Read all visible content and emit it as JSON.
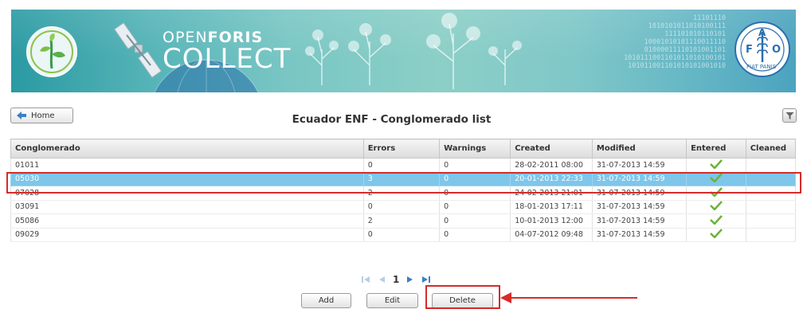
{
  "banner": {
    "brand_line1_light": "OPEN",
    "brand_line1_bold": "FORIS",
    "brand_line2": "COLLECT",
    "binary_text": "11101110\n1010101011010100111\n111101010110101\n10001010101110011110\n01000011110101001101\n1010111001101011010100101\n101011001101010101001010",
    "fao_letters": "F A O",
    "fao_motto": "FIAT PANIS"
  },
  "toolbar": {
    "home_label": "Home",
    "page_title": "Ecuador ENF - Conglomerado list"
  },
  "grid": {
    "columns": [
      "Conglomerado",
      "Errors",
      "Warnings",
      "Created",
      "Modified",
      "Entered",
      "Cleaned"
    ],
    "rows": [
      {
        "id": "01011",
        "errors": "0",
        "warnings": "0",
        "created": "28-02-2011 08:00",
        "modified": "31-07-2013 14:59",
        "entered": true,
        "cleaned": ""
      },
      {
        "id": "05030",
        "errors": "3",
        "warnings": "0",
        "created": "20-01-2013 22:33",
        "modified": "31-07-2013 14:59",
        "entered": true,
        "cleaned": ""
      },
      {
        "id": "07028",
        "errors": "2",
        "warnings": "0",
        "created": "24-02-2013 21:01",
        "modified": "31-07-2013 14:59",
        "entered": true,
        "cleaned": ""
      },
      {
        "id": "03091",
        "errors": "0",
        "warnings": "0",
        "created": "18-01-2013 17:11",
        "modified": "31-07-2013 14:59",
        "entered": true,
        "cleaned": ""
      },
      {
        "id": "05086",
        "errors": "2",
        "warnings": "0",
        "created": "10-01-2013 12:00",
        "modified": "31-07-2013 14:59",
        "entered": true,
        "cleaned": ""
      },
      {
        "id": "09029",
        "errors": "0",
        "warnings": "0",
        "created": "04-07-2012 09:48",
        "modified": "31-07-2013 14:59",
        "entered": true,
        "cleaned": ""
      }
    ],
    "selected_row_id": "05030"
  },
  "pager": {
    "current_page": "1"
  },
  "actions": {
    "add_label": "Add",
    "edit_label": "Edit",
    "delete_label": "Delete"
  },
  "colors": {
    "selected_row": "#7ec6ea",
    "highlight_red": "#d62b2b",
    "check_green": "#6bb33a",
    "pager_blue": "#3b7fc4"
  },
  "icons": {
    "home": "arrow-left-icon",
    "filter": "filter-icon",
    "entered": "checkmark-icon",
    "pager": [
      "first-page-icon",
      "prev-page-icon",
      "next-page-icon",
      "last-page-icon"
    ]
  }
}
